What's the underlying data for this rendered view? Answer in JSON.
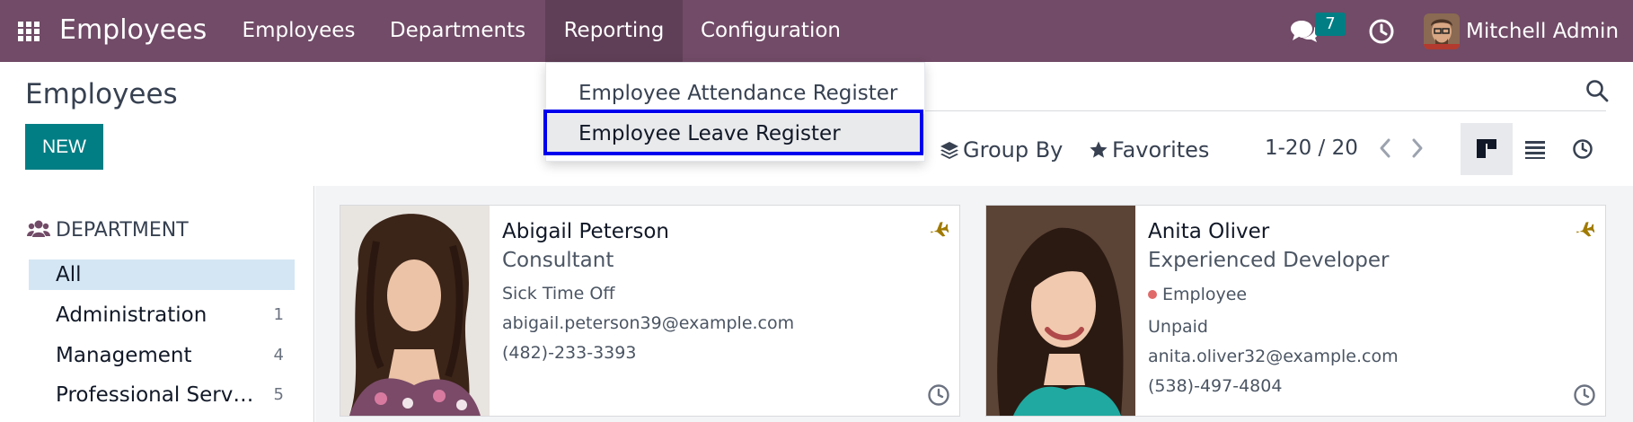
{
  "app": {
    "brand": "Employees"
  },
  "menu": [
    {
      "label": "Employees"
    },
    {
      "label": "Departments"
    },
    {
      "label": "Reporting"
    },
    {
      "label": "Configuration"
    }
  ],
  "systray": {
    "chat_count": "7",
    "user_name": "Mitchell Admin"
  },
  "reporting_dropdown": {
    "items": [
      {
        "label": "Employee Attendance Register"
      },
      {
        "label": "Employee Leave Register"
      }
    ]
  },
  "control_panel": {
    "title": "Employees",
    "new_label": "NEW",
    "group_by_label": "Group By",
    "favorites_label": "Favorites",
    "pager": "1-20 / 20"
  },
  "sidebar": {
    "header": "DEPARTMENT",
    "items": [
      {
        "label": "All",
        "count": ""
      },
      {
        "label": "Administration",
        "count": "1"
      },
      {
        "label": "Management",
        "count": "4"
      },
      {
        "label": "Professional Services",
        "count": "5"
      }
    ]
  },
  "employees": [
    {
      "name": "Abigail Peterson",
      "job": "Consultant",
      "line1": "Sick Time Off",
      "email": "abigail.peterson39@example.com",
      "phone": "(482)-233-3393"
    },
    {
      "name": "Anita Oliver",
      "job": "Experienced Developer",
      "tag": "Employee",
      "line1": "Unpaid",
      "email": "anita.oliver32@example.com",
      "phone": "(538)-497-4804"
    }
  ],
  "colors": {
    "navbar": "#714b67",
    "primary": "#017e84",
    "highlight_border": "#0000ee",
    "status_icon": "#a07a00"
  }
}
